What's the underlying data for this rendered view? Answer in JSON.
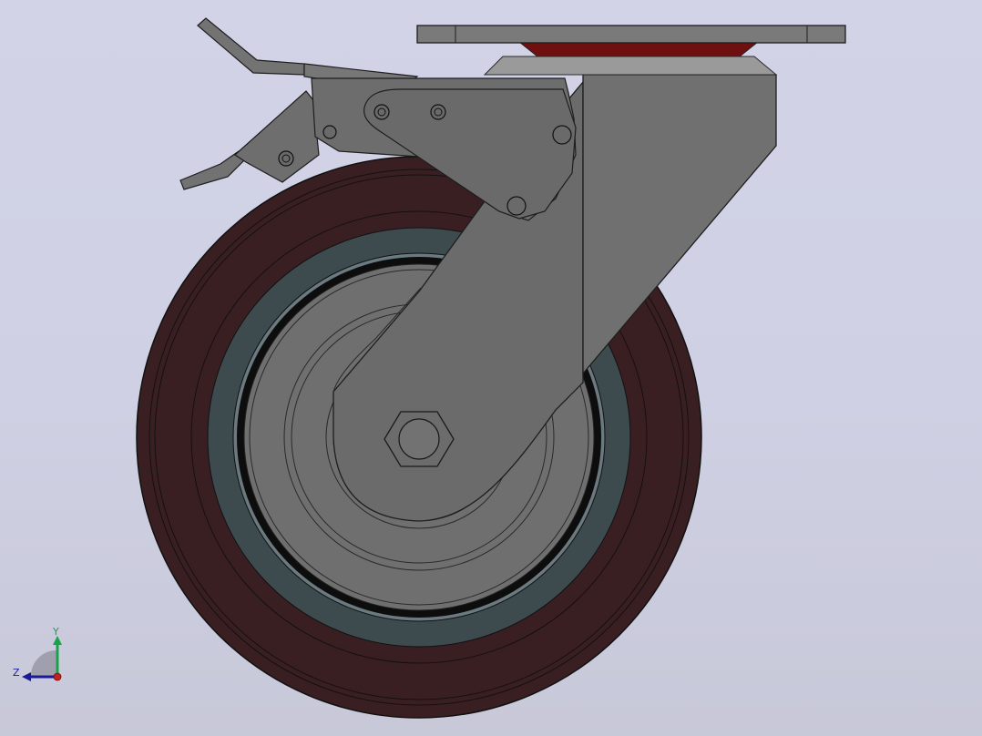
{
  "viewport": {
    "background_top": "#d2d3e7",
    "background_bottom": "#c7c8d8"
  },
  "model": {
    "tire_color": "#3a1f22",
    "tread_inner_color": "#3d4a4e",
    "hub_color": "#6f6f6f",
    "bracket_color": "#6b6b6b",
    "plate_color": "#7a7a7a",
    "bearing_color": "#6e1010"
  },
  "triad": {
    "y_label": "Y",
    "z_label": "Z",
    "y_color": "#17a34a",
    "z_color": "#1a1aa8",
    "x_color": "#c81e1e"
  }
}
